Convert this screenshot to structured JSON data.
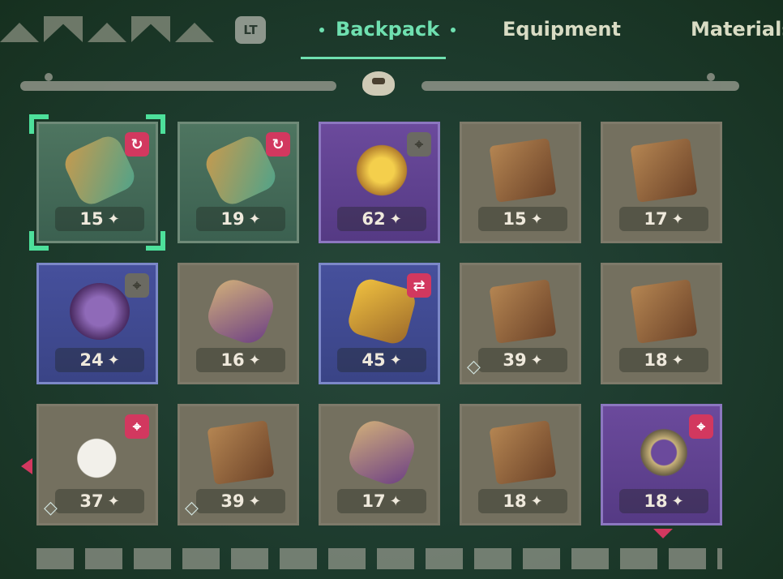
{
  "header": {
    "trigger_label": "LT",
    "tabs": [
      {
        "label": "Backpack",
        "active": true
      },
      {
        "label": "Equipment",
        "active": false
      },
      {
        "label": "Materials",
        "active": false
      }
    ]
  },
  "icons": {
    "bag": "backpack-icon",
    "refresh": "refresh-icon",
    "swap": "swap-icon",
    "target": "target-icon",
    "gem": "gem-icon",
    "sparkle": "sparkle-icon"
  },
  "colors": {
    "accent": "#6fe0b0",
    "badge_red": "#d2385f",
    "selection": "#4de09b"
  },
  "inventory": [
    {
      "count": "15",
      "item": "feather-charm",
      "color": "green",
      "badge": "refresh",
      "selected": true,
      "gem": false
    },
    {
      "count": "19",
      "item": "feather-charm",
      "color": "green",
      "badge": "refresh",
      "selected": false,
      "gem": false
    },
    {
      "count": "62",
      "item": "golden-spark",
      "color": "purple",
      "badge": "target-grey",
      "selected": false,
      "gem": false
    },
    {
      "count": "15",
      "item": "wooden-chest",
      "color": "brown",
      "badge": "",
      "selected": false,
      "gem": false
    },
    {
      "count": "17",
      "item": "wooden-chest",
      "color": "brown",
      "badge": "",
      "selected": false,
      "gem": false
    },
    {
      "count": "24",
      "item": "purple-orb",
      "color": "blue",
      "badge": "target-grey",
      "selected": false,
      "gem": false
    },
    {
      "count": "16",
      "item": "purple-fish",
      "color": "brown",
      "badge": "",
      "selected": false,
      "gem": false
    },
    {
      "count": "45",
      "item": "golden-key",
      "color": "blue",
      "badge": "swap",
      "selected": false,
      "gem": false
    },
    {
      "count": "39",
      "item": "wooden-chest",
      "color": "brown",
      "badge": "",
      "selected": false,
      "gem": true
    },
    {
      "count": "18",
      "item": "wooden-chest",
      "color": "brown",
      "badge": "",
      "selected": false,
      "gem": false
    },
    {
      "count": "37",
      "item": "white-swan",
      "color": "brown",
      "badge": "target",
      "selected": false,
      "gem": true
    },
    {
      "count": "39",
      "item": "wooden-chest",
      "color": "brown",
      "badge": "",
      "selected": false,
      "gem": true
    },
    {
      "count": "17",
      "item": "purple-fish",
      "color": "brown",
      "badge": "",
      "selected": false,
      "gem": false
    },
    {
      "count": "18",
      "item": "wooden-chest",
      "color": "brown",
      "badge": "",
      "selected": false,
      "gem": false
    },
    {
      "count": "18",
      "item": "gear-ring",
      "color": "purple",
      "badge": "target",
      "selected": false,
      "gem": false
    }
  ]
}
